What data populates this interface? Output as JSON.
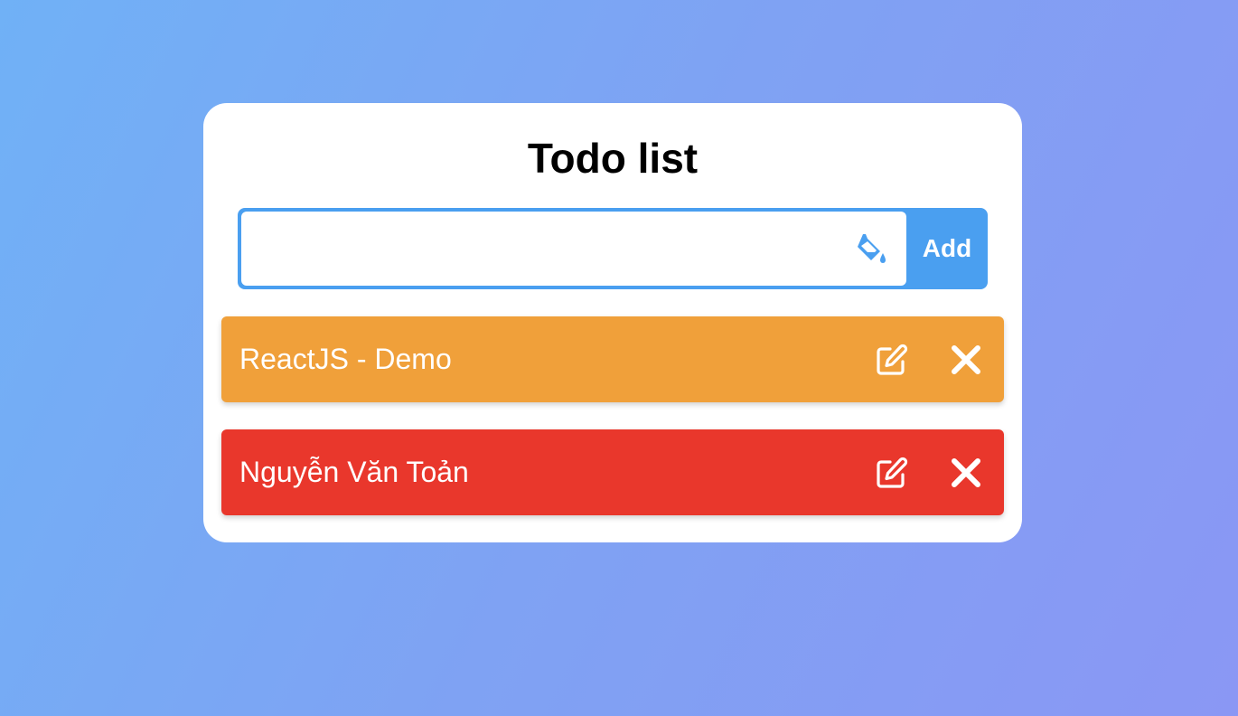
{
  "title": "Todo list",
  "input": {
    "value": "",
    "placeholder": "",
    "icon": "paint-bucket-icon",
    "add_label": "Add"
  },
  "todos": [
    {
      "text": "ReactJS - Demo",
      "color": "#f0a03a",
      "edit_icon": "edit-icon",
      "delete_icon": "close-icon"
    },
    {
      "text": "Nguyễn Văn Toản",
      "color": "#e9372c",
      "edit_icon": "edit-icon",
      "delete_icon": "close-icon"
    }
  ],
  "colors": {
    "accent": "#4a9ff0",
    "background_start": "#70b1f6",
    "background_end": "#8a97f4"
  }
}
